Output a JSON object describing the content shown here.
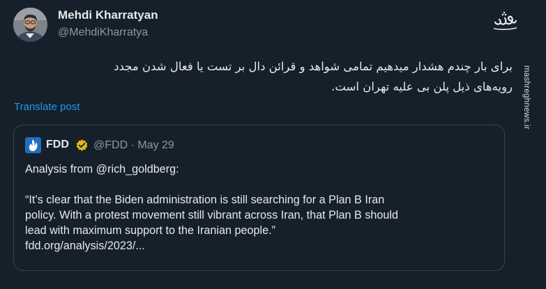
{
  "tweet": {
    "author_name": "Mehdi Kharratyan",
    "author_handle": "@MehdiKharratya",
    "text_line_1": "برای بار چندم هشدار میدهیم تمامی شواهد و قرائن دال بر تست یا فعال شدن مجدد",
    "text_line_2": "رویه‌های ذیل پلن بی علیه تهران است.",
    "translate_label": "Translate post",
    "avatar_icon": "user-avatar-photo"
  },
  "watermark": {
    "site": "mashreghnews.ir",
    "logo_icon": "mashregh-logo"
  },
  "quoted": {
    "name": "FDD",
    "handle": "@FDD",
    "separator": "·",
    "date": "May 29",
    "verified_icon": "gold-verified-badge",
    "logo_icon": "fdd-flame-logo",
    "intro": "Analysis from @rich_goldberg:",
    "quote_lines": [
      "“It’s clear that the Biden administration is still searching for a Plan B Iran",
      "policy. With a protest movement still vibrant across Iran, that Plan B should",
      "lead with maximum support to the Iranian people.”"
    ],
    "link": "fdd.org/analysis/2023/..."
  },
  "colors": {
    "background": "#15202b",
    "link": "#1d9bf0",
    "muted": "#8b98a5",
    "border": "#38444d",
    "verified_gold": "#e2b719"
  }
}
